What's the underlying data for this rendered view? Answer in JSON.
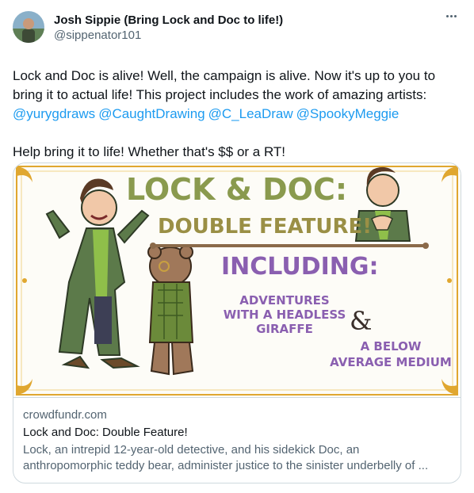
{
  "author": {
    "name": "Josh Sippie (Bring Lock and Doc to life!)",
    "handle": "@sippenator101"
  },
  "tweet": {
    "line1": "Lock and Doc is alive! Well, the campaign is alive. Now it's up to you to bring it to actual life! This project includes the work of amazing artists:",
    "mentions": [
      "@yurygdraws",
      "@CaughtDrawing",
      "@C_LeaDraw",
      "@SpookyMeggie"
    ],
    "line2": "Help bring it to life! Whether that's $$ or a RT!"
  },
  "card": {
    "image": {
      "title": "LOCK & DOC:",
      "subtitle": "DOUBLE FEATURE!",
      "including": "INCLUDING:",
      "story1": [
        "ADVENTURES",
        "WITH A HEADLESS",
        "GIRAFFE"
      ],
      "ampersand": "&",
      "story2": [
        "A BELOW",
        "AVERAGE MEDIUM"
      ]
    },
    "domain": "crowdfundr.com",
    "title": "Lock and Doc: Double Feature!",
    "description_line1": "Lock, an intrepid 12-year-old detective, and his sidekick Doc, an",
    "description_line2": "anthropomorphic teddy bear, administer justice to the sinister underbelly of ..."
  },
  "colors": {
    "accent": "#1d9bf0",
    "title_green": "#8a9a4e",
    "subtitle_olive": "#9a8f45",
    "including_purple": "#8a5fb0",
    "border_gold": "#e0a730"
  },
  "icons": {
    "more": "more-horizontal-icon"
  }
}
